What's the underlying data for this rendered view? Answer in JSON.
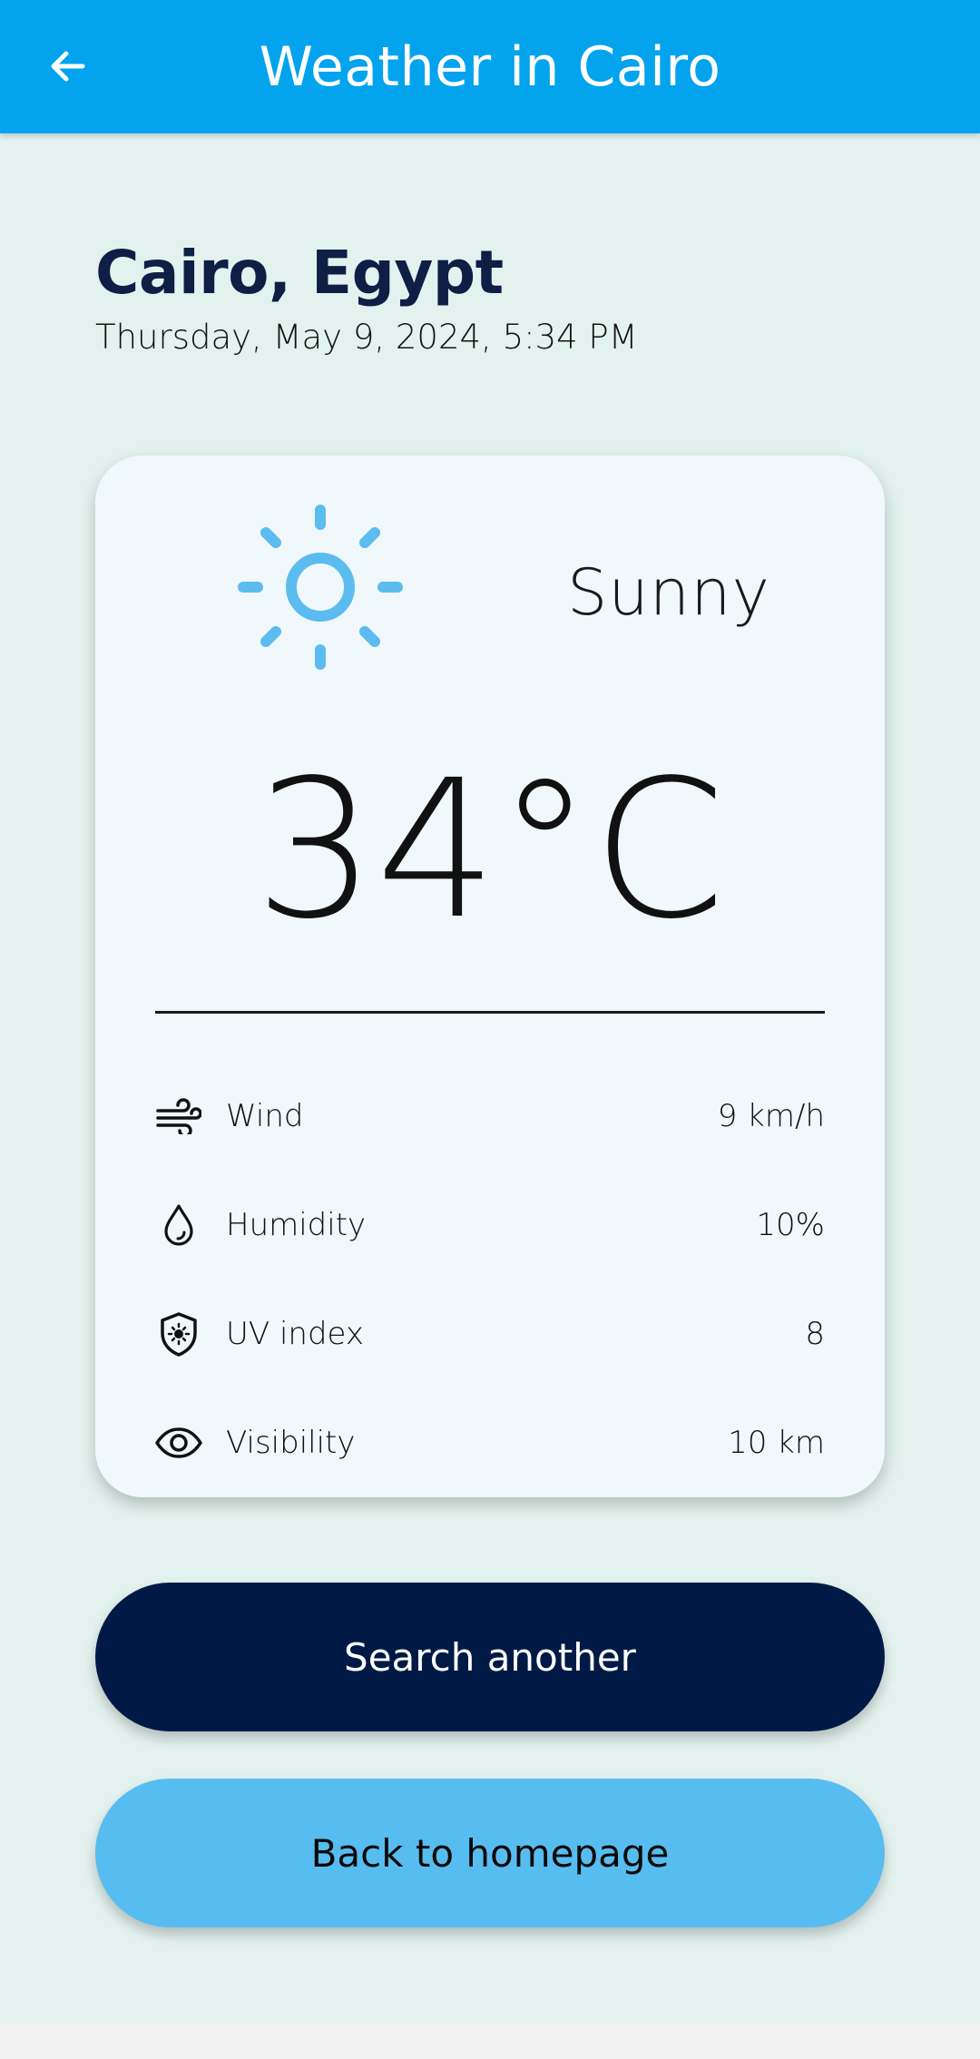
{
  "header": {
    "title": "Weather in Cairo",
    "back_icon": "arrow-left-icon",
    "background_color": "#03a3ee"
  },
  "location": {
    "city": "Cairo, Egypt",
    "datetime": "Thursday, May 9, 2024, 5:34 PM"
  },
  "weather": {
    "icon": "sun-icon",
    "icon_color": "#5bbcf0",
    "condition": "Sunny",
    "temperature": "34°C",
    "details": [
      {
        "icon": "wind-icon",
        "label": "Wind",
        "value": "9 km/h"
      },
      {
        "icon": "droplet-icon",
        "label": "Humidity",
        "value": "10%"
      },
      {
        "icon": "uv-shield-icon",
        "label": "UV index",
        "value": "8"
      },
      {
        "icon": "eye-icon",
        "label": "Visibility",
        "value": "10 km"
      }
    ]
  },
  "actions": {
    "search_another": "Search another",
    "back_home": "Back to homepage",
    "primary_color": "#001a45",
    "secondary_color": "#57bdf1"
  }
}
